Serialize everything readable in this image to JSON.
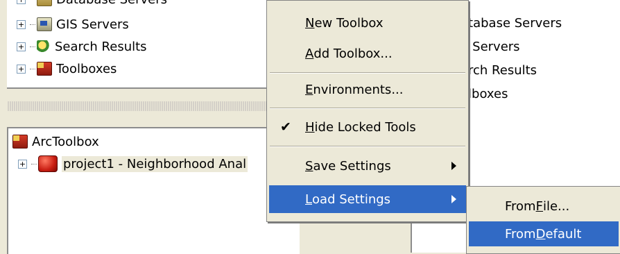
{
  "catalog_tree": {
    "items": [
      {
        "label": "Database Servers",
        "icon": "database-server-icon"
      },
      {
        "label": "GIS Servers",
        "icon": "gis-server-icon"
      },
      {
        "label": "Search Results",
        "icon": "search-results-icon"
      },
      {
        "label": "Toolboxes",
        "icon": "toolbox-icon"
      }
    ]
  },
  "toolbox_tree": {
    "root_label": "ArcToolbox",
    "child_label": "project1 - Neighborhood Anal"
  },
  "contents_pane": {
    "items": [
      "atabase Servers",
      "S Servers",
      "arch Results",
      "olboxes"
    ]
  },
  "context_menu": {
    "items": [
      {
        "mnemonic": "N",
        "rest": "ew Toolbox"
      },
      {
        "mnemonic": "A",
        "rest": "dd Toolbox..."
      },
      {
        "mnemonic": "E",
        "rest": "nvironments..."
      },
      {
        "mnemonic": "H",
        "rest": "ide Locked Tools",
        "checked": true
      },
      {
        "mnemonic": "S",
        "rest": "ave Settings",
        "submenu": true
      },
      {
        "mnemonic": "L",
        "rest": "oad Settings",
        "submenu": true,
        "highlighted": true
      }
    ]
  },
  "load_submenu": {
    "items": [
      {
        "before": "From ",
        "mnemonic": "F",
        "after": "ile..."
      },
      {
        "before": "From ",
        "mnemonic": "D",
        "after": "efault",
        "highlighted": true
      }
    ]
  },
  "colors": {
    "highlight": "#316ac5",
    "face": "#ece9d8"
  }
}
